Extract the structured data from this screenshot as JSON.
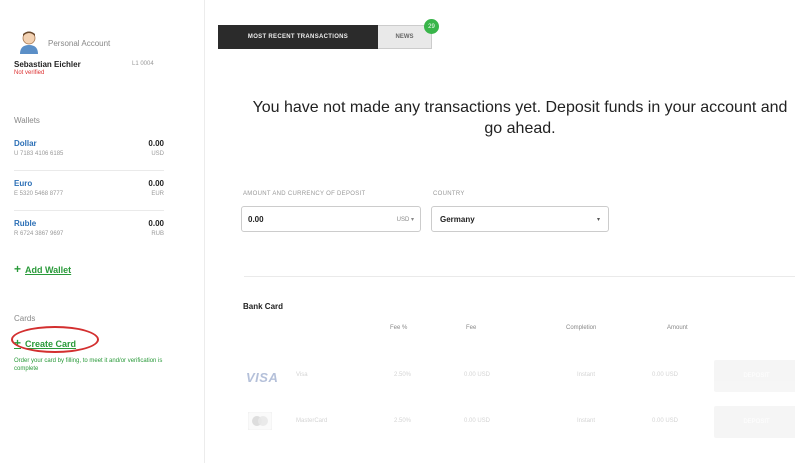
{
  "sidebar": {
    "account_type": "Personal Account",
    "user_name": "Sebastian Eichler",
    "user_id": "L1 0004",
    "verification_status": "Not verified",
    "wallets_label": "Wallets",
    "wallets": [
      {
        "name": "Dollar",
        "number": "U 7183 4106 6185",
        "balance": "0.00",
        "currency": "USD"
      },
      {
        "name": "Euro",
        "number": "E 5320 5468 8777",
        "balance": "0.00",
        "currency": "EUR"
      },
      {
        "name": "Ruble",
        "number": "R 6724 3867 9697",
        "balance": "0.00",
        "currency": "RUB"
      }
    ],
    "add_wallet_label": "Add Wallet",
    "cards_label": "Cards",
    "create_card_label": "Create Card",
    "card_note": "Order your card by filling, to meet it and/or verification is complete"
  },
  "tabs": [
    {
      "label": "MOST RECENT TRANSACTIONS"
    },
    {
      "label": "NEWS",
      "badge": "29"
    }
  ],
  "main": {
    "headline": "You have not made any transactions yet. Deposit funds in your account and go ahead.",
    "amount_label": "AMOUNT AND CURRENCY OF DEPOSIT",
    "amount_value": "0.00",
    "amount_currency": "USD ▾",
    "country_label": "COUNTRY",
    "country_value": "Germany",
    "country_caret": "▾",
    "bank_card_title": "Bank Card",
    "columns": [
      "Fee %",
      "Fee",
      "Completion",
      "Amount"
    ],
    "methods": [
      {
        "logo": "VISA",
        "name": "Visa",
        "fee_pct": "2.50%",
        "fee": "0.00 USD",
        "completion": "Instant",
        "amount": "0.00 USD",
        "button": "DEPOSIT"
      },
      {
        "logo": "mastercard-icon",
        "name": "MasterCard",
        "fee_pct": "2.50%",
        "fee": "0.00 USD",
        "completion": "Instant",
        "amount": "0.00 USD",
        "button": "DEPOSIT"
      }
    ]
  },
  "colors": {
    "link_green": "#2a9a3a",
    "wallet_blue": "#2b6fb6",
    "annotation_red": "#d32f2f",
    "tab_dark": "#2b2b2b"
  }
}
